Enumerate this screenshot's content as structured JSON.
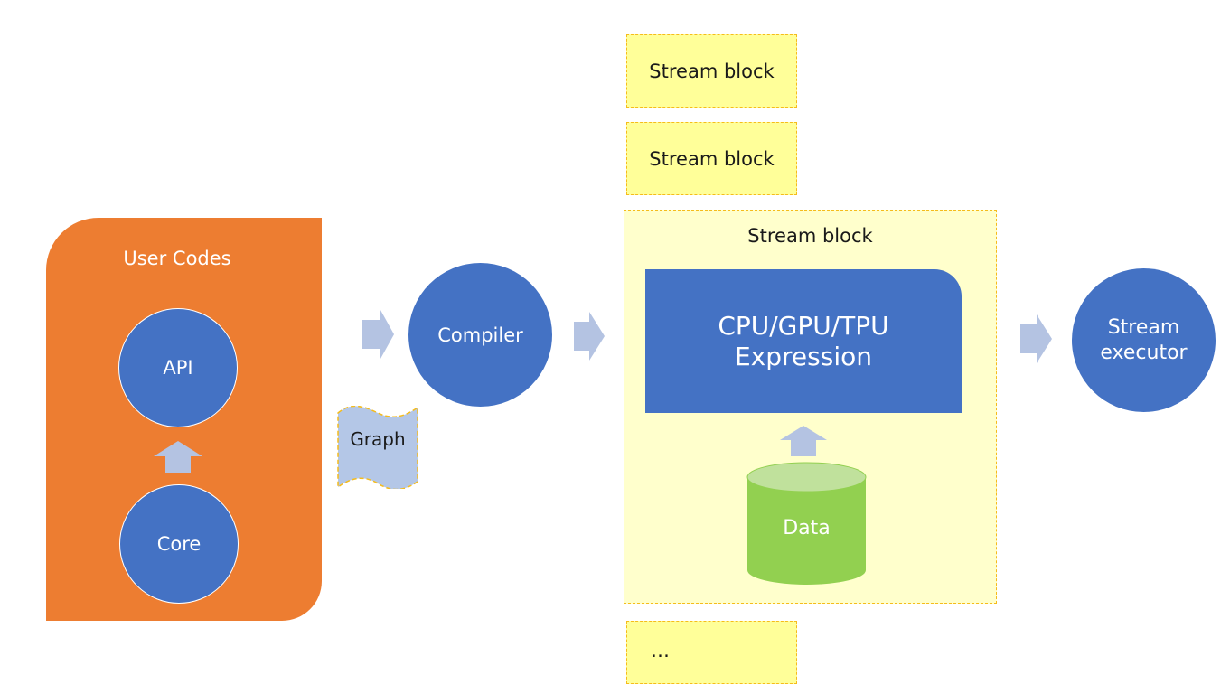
{
  "diagram": {
    "user_codes": {
      "title": "User Codes",
      "api": "API",
      "core": "Core"
    },
    "graph": "Graph",
    "compiler": "Compiler",
    "stream_blocks": [
      {
        "label": "Stream block"
      },
      {
        "label": "Stream block"
      }
    ],
    "main_stream_block": {
      "label": "Stream block",
      "expression_line1": "CPU/GPU/TPU",
      "expression_line2": "Expression",
      "data": "Data"
    },
    "ellipsis_block": "…",
    "executor_line1": "Stream",
    "executor_line2": "executor",
    "colors": {
      "orange": "#ED7D31",
      "blue": "#4472C4",
      "arrow": "#B4C3E2",
      "yellow": "#FFFF99",
      "pale_yellow": "#FFFFCC",
      "green": "#92D050",
      "border": "#F5BC1C"
    }
  }
}
